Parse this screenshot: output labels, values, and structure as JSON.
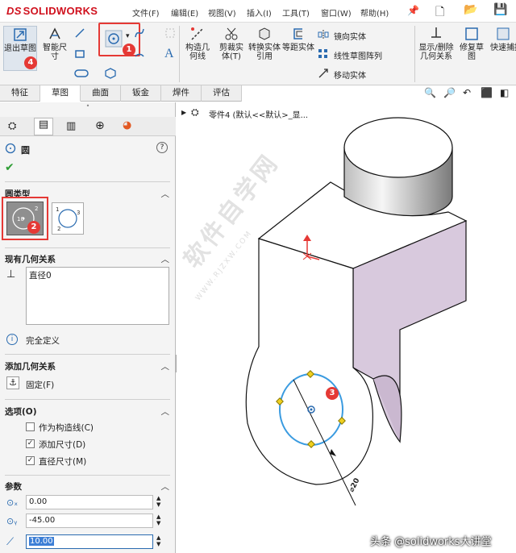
{
  "app": {
    "logo": "SOLIDWORKS"
  },
  "menu": [
    "文件(F)",
    "编辑(E)",
    "视图(V)",
    "插入(I)",
    "工具(T)",
    "窗口(W)",
    "帮助(H)"
  ],
  "ribbon": {
    "exit_sketch": "退出草图",
    "smart_dim": "智能尺寸",
    "construct": "构造几何线",
    "trim": "剪裁实体(T)",
    "convert": "转换实体引用",
    "offset": "等距实体",
    "mirror": "镜向实体",
    "linear_pattern": "线性草图阵列",
    "move": "移动实体",
    "show_relations": "显示/删除几何关系",
    "repair": "修复草图",
    "quick": "快速捕捉"
  },
  "tabs": [
    "特征",
    "草图",
    "曲面",
    "钣金",
    "焊件",
    "评估"
  ],
  "active_tab": "草图",
  "tree": {
    "item": "零件4 (默认<<默认>_显..."
  },
  "panel": {
    "title": "圆",
    "circle_type_label": "圆类型",
    "existing_relations_label": "现有几何关系",
    "relation_item": "直径0",
    "status": "完全定义",
    "add_relations_label": "添加几何关系",
    "fix_label": "固定(F)",
    "options_label": "选项(O)",
    "opt_construction": "作为构造线(C)",
    "opt_add_dim": "添加尺寸(D)",
    "opt_diameter": "直径尺寸(M)",
    "params_label": "参数",
    "param_x": "0.00",
    "param_y": "-45.00",
    "param_r": "10.00"
  },
  "markers": {
    "m1": "1",
    "m2": "2",
    "m3": "3",
    "m4": "4"
  },
  "dimension": "⌀20",
  "watermark": "软件自学网",
  "watermark_url": "WWW.RJZXW.COM",
  "credit": "头条 @solidworks大讲堂"
}
